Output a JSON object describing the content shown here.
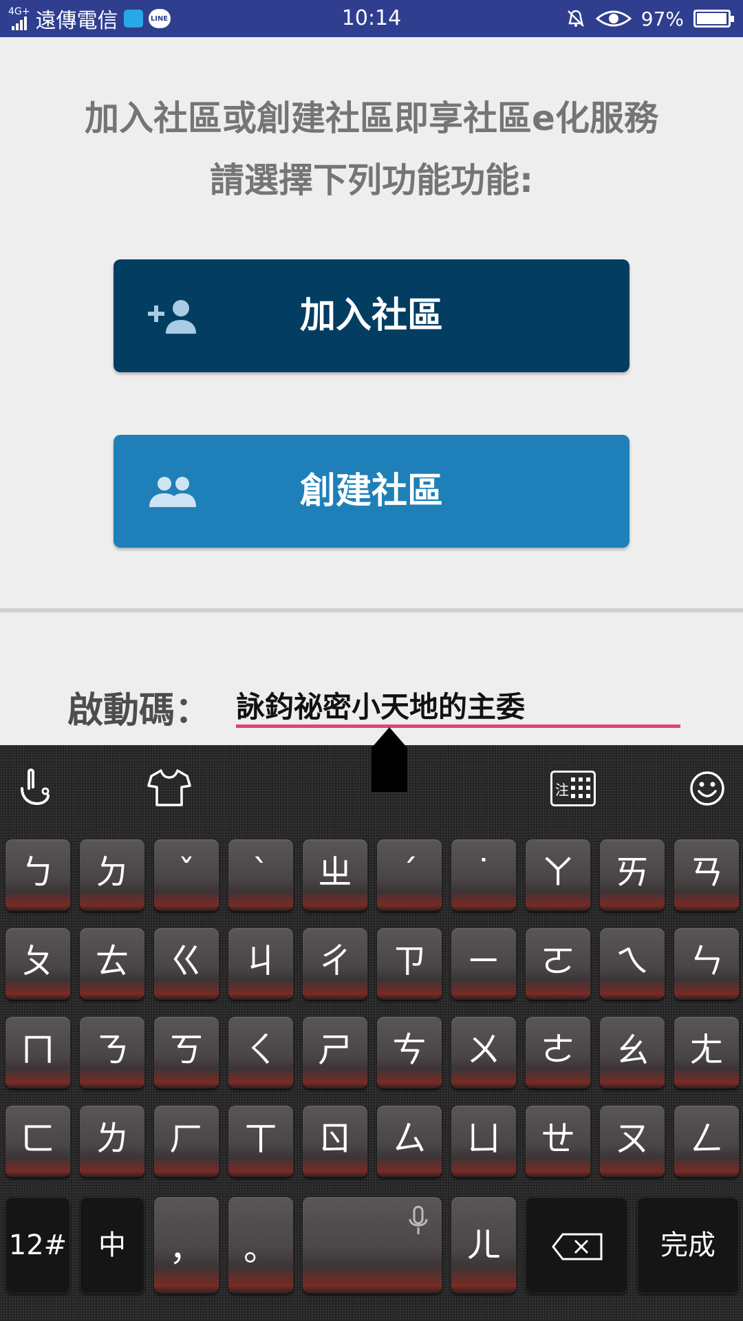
{
  "status_bar": {
    "network": "4G+",
    "carrier": "遠傳電信",
    "line_label": "LINE",
    "time": "10:14",
    "battery_percent": "97%",
    "battery_level": 0.97
  },
  "prompt": {
    "line1": "加入社區或創建社區即享社區e化服務",
    "line2": "請選擇下列功能功能:"
  },
  "buttons": {
    "join_label": "加入社區",
    "create_label": "創建社區"
  },
  "activation": {
    "label": "啟動碼：",
    "value": "詠鈞祕密小天地的主委"
  },
  "keyboard": {
    "rows": [
      [
        "ㄅ",
        "ㄉ",
        "ˇ",
        "ˋ",
        "ㄓ",
        "ˊ",
        "˙",
        "ㄚ",
        "ㄞ",
        "ㄢ"
      ],
      [
        "ㄆ",
        "ㄊ",
        "ㄍ",
        "ㄐ",
        "ㄔ",
        "ㄗ",
        "ㄧ",
        "ㄛ",
        "ㄟ",
        "ㄣ"
      ],
      [
        "ㄇ",
        "ㄋ",
        "ㄎ",
        "ㄑ",
        "ㄕ",
        "ㄘ",
        "ㄨ",
        "ㄜ",
        "ㄠ",
        "ㄤ"
      ],
      [
        "ㄈ",
        "ㄌ",
        "ㄏ",
        "ㄒ",
        "ㄖ",
        "ㄙ",
        "ㄩ",
        "ㄝ",
        "ㄡ",
        "ㄥ"
      ]
    ],
    "bottom": {
      "symbols": "12#",
      "lang": "中",
      "comma": "，",
      "period": "。",
      "er": "ㄦ",
      "done": "完成"
    },
    "toolbar_zhuyin": "注"
  }
}
